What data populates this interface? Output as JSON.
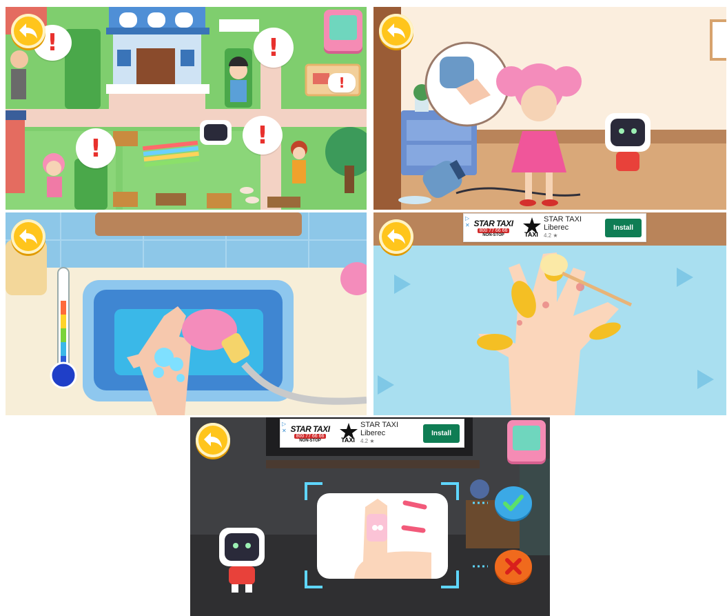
{
  "panels": {
    "town": {
      "alerts": [
        "!",
        "!",
        "!",
        "!",
        "!"
      ]
    },
    "kitchen": {},
    "sink": {},
    "ointment": {
      "ad": {
        "brand_top": "STAR TAXI",
        "phone": "800 77 66 66",
        "non_stop": "NON-STOP",
        "logo_word": "TAXI",
        "name": "STAR TAXI",
        "city": "Liberec",
        "rating": "4.2 ★",
        "install": "Install"
      }
    },
    "bandage": {
      "ad": {
        "brand_top": "STAR TAXI",
        "phone": "800 77 66 66",
        "non_stop": "NON-STOP",
        "logo_word": "TAXI",
        "name": "STAR TAXI",
        "city": "Liberec",
        "rating": "4.2 ★",
        "install": "Install"
      }
    }
  },
  "colors": {
    "back_button": "#ffc51c",
    "confirm": "#3ba9e6",
    "reject": "#f06a1d",
    "install": "#0f7d54"
  },
  "icons": [
    "back-arrow-icon",
    "book-icon",
    "check-icon",
    "cross-icon",
    "exclamation-icon",
    "thermometer-icon"
  ]
}
